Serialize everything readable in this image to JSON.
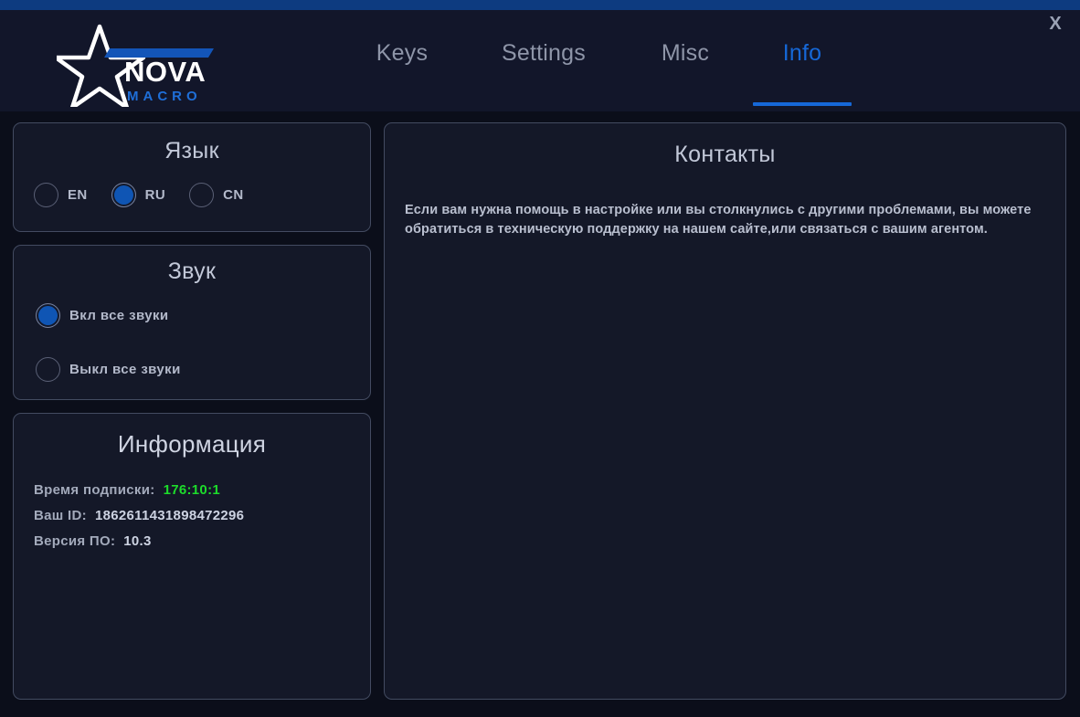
{
  "window": {
    "close_label": "X"
  },
  "logo": {
    "brand": "NOVA",
    "sub_brand": "MACRO",
    "star_icon": "star-icon"
  },
  "tabs": [
    {
      "id": "keys",
      "label": "Keys",
      "active": false
    },
    {
      "id": "settings",
      "label": "Settings",
      "active": false
    },
    {
      "id": "misc",
      "label": "Misc",
      "active": false
    },
    {
      "id": "info",
      "label": "Info",
      "active": true
    }
  ],
  "language_panel": {
    "title": "Язык",
    "options": [
      {
        "label": "EN",
        "selected": false
      },
      {
        "label": "RU",
        "selected": true
      },
      {
        "label": "CN",
        "selected": false
      }
    ]
  },
  "sound_panel": {
    "title": "Звук",
    "options": [
      {
        "label": "Вкл все звуки",
        "selected": true
      },
      {
        "label": "Выкл все звуки",
        "selected": false
      }
    ]
  },
  "information_panel": {
    "title": "Информация",
    "rows": [
      {
        "key": "Время подписки:",
        "value": "176:10:1",
        "highlight": true
      },
      {
        "key": "Ваш ID:",
        "value": "1862611431898472296",
        "highlight": false
      },
      {
        "key": "Версия ПО:",
        "value": "10.3",
        "highlight": false
      }
    ]
  },
  "contacts_panel": {
    "title": "Контакты",
    "body": "Если вам нужна помощь в настройке или вы столкнулись с другими проблемами, вы можете обратиться в техническую поддержку на нашем сайте,или связаться с вашим агентом."
  },
  "colors": {
    "accent_blue": "#1668d8",
    "titlebar_blue": "#0d3b80",
    "radio_blue": "#0f55b4",
    "green_value": "#1ddc2b",
    "panel_bg": "#141828",
    "panel_border": "#434b61",
    "header_bg": "#12162a",
    "body_bg": "#0b0e1a"
  }
}
